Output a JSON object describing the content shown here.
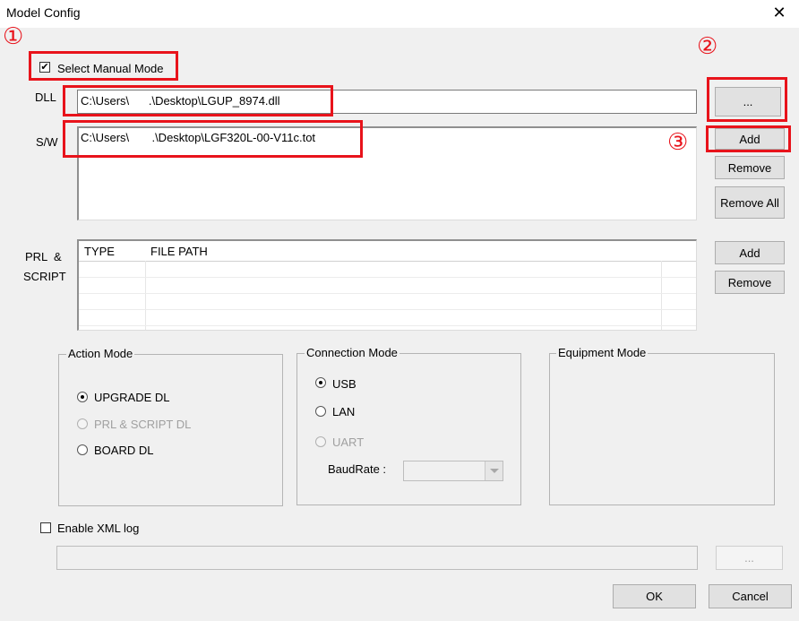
{
  "window": {
    "title": "Model Config",
    "close_glyph": "✕"
  },
  "manual_mode": {
    "label": "Select Manual Mode",
    "checked": true
  },
  "dll": {
    "label": "DLL",
    "value": "C:\\Users\\      .\\Desktop\\LGUP_8974.dll",
    "browse_label": "..."
  },
  "sw": {
    "label": "S/W",
    "items": [
      "C:\\Users\\       .\\Desktop\\LGF320L-00-V11c.tot"
    ],
    "add_label": "Add",
    "remove_label": "Remove",
    "remove_all_label": "Remove All"
  },
  "prl_script": {
    "label_line1": "PRL  &",
    "label_line2": "SCRIPT",
    "columns": [
      "TYPE",
      "FILE PATH"
    ],
    "add_label": "Add",
    "remove_label": "Remove"
  },
  "action_mode": {
    "title": "Action Mode",
    "options": [
      {
        "label": "UPGRADE DL",
        "selected": true,
        "enabled": true
      },
      {
        "label": "PRL & SCRIPT DL",
        "selected": false,
        "enabled": false
      },
      {
        "label": "BOARD DL",
        "selected": false,
        "enabled": true
      }
    ]
  },
  "connection_mode": {
    "title": "Connection Mode",
    "options": [
      {
        "label": "USB",
        "selected": true,
        "enabled": true
      },
      {
        "label": "LAN",
        "selected": false,
        "enabled": true
      },
      {
        "label": "UART",
        "selected": false,
        "enabled": false
      }
    ],
    "baudrate_label": "BaudRate :",
    "baudrate_value": ""
  },
  "equipment_mode": {
    "title": "Equipment Mode"
  },
  "xml_log": {
    "label": "Enable XML log",
    "checked": false,
    "path": "",
    "browse_label": "..."
  },
  "footer": {
    "ok_label": "OK",
    "cancel_label": "Cancel"
  },
  "annotations": {
    "one": "①",
    "two": "②",
    "three": "③"
  },
  "colors": {
    "highlight": "#e8131b",
    "background": "#f0f0f0",
    "titlebar": "#ffffff"
  }
}
